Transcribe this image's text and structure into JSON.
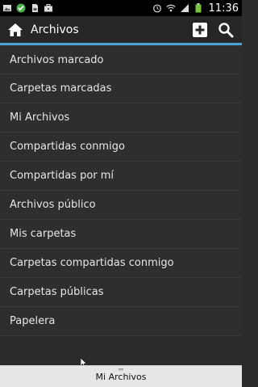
{
  "status_bar": {
    "time": "11:36",
    "icons": [
      "image-icon",
      "check-icon",
      "sim-card-icon",
      "briefcase-icon",
      "alarm-icon",
      "wifi-icon",
      "signal-icon",
      "battery-icon"
    ]
  },
  "action_bar": {
    "title": "Archivos",
    "accent": "#4aa3d6",
    "icons": [
      "home-icon",
      "add-icon",
      "search-icon"
    ]
  },
  "menu": {
    "items": [
      {
        "label": "Archivos marcado"
      },
      {
        "label": "Carpetas marcadas"
      },
      {
        "label": "Mi Archivos"
      },
      {
        "label": "Compartidas conmigo"
      },
      {
        "label": "Compartidas por mí"
      },
      {
        "label": "Archivos público"
      },
      {
        "label": "Mis carpetas"
      },
      {
        "label": "Carpetas compartidas conmigo"
      },
      {
        "label": "Carpetas públicas"
      },
      {
        "label": "Papelera"
      }
    ]
  },
  "bottom_bar": {
    "label": "Mi Archivos"
  }
}
